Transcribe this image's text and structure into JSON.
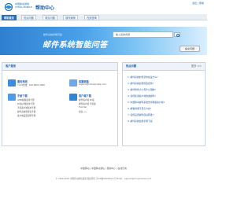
{
  "header": {
    "logo_text": "中国移动通信 CHINA MOBILE",
    "title": "帮助中心",
    "top_links": "退出 | 帮助"
  },
  "nav": {
    "tabs": [
      {
        "label": "帮助首页",
        "active": true
      },
      {
        "label": "热点问题",
        "active": false
      },
      {
        "label": "常见问题",
        "active": false
      },
      {
        "label": "操作案例",
        "active": false
      },
      {
        "label": "在线咨询",
        "active": false
      }
    ]
  },
  "banner": {
    "subtitle": "邮件系统智能问答",
    "main_text": "邮件系统智能问答",
    "search_placeholder": "输入您的问题",
    "submit_label": "提交问题"
  },
  "service": {
    "heading": "客户服务",
    "items": [
      {
        "title": "服务热线",
        "lines": [
          "7×24热线：010-5861 2000"
        ],
        "color": "#3a8ee0"
      },
      {
        "title": "客服邮箱",
        "lines": [
          "support@chinamobile.com"
        ],
        "color": "#6aa8e8"
      },
      {
        "title": "手册下载",
        "lines": [
          "WEB邮箱使用手册",
          "PC客户端使用手册",
          "手机客户端使用手册",
          "邮件系统管理员手册",
          "客户端设置说明手册"
        ],
        "color": "#4c9de8"
      },
      {
        "title": "客户端下载",
        "lines": [
          "邮件客户端 PC版",
          "邮件客户端 手机版",
          "Foxmail",
          "更多 >>"
        ],
        "color": "#2f86d6"
      }
    ]
  },
  "faq": {
    "heading": "热点问题",
    "more": "更多 >>",
    "items": [
      "1. 邮件系统的登录地址是什么?",
      "2. 邮件系统如何修改密码?",
      "3. 邮件附件大小有什么限制?",
      "4. 如何使用客户端收发邮件?",
      "5. 中国移动邮件系统支持哪些客户端?",
      "6. 邮箱容量不足怎么办?",
      "7. 如何设置邮件自动转发?",
      "8. 邮件系统使用手册下载"
    ]
  },
  "footer": {
    "links": "中国移动 | 中国移动通信 | 帮助中心 | 在线咨询",
    "copyright": "© 2016-2024 中国移动通信集团 版权所有 京ICP备05002571号 Email：support@chinamobile.com"
  }
}
